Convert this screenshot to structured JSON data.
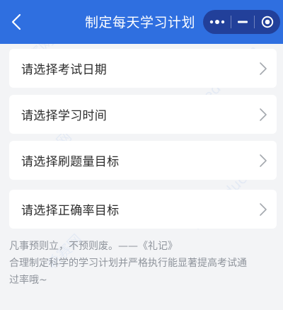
{
  "header": {
    "title": "制定每天学习计划",
    "back_icon": "chevron-left-icon",
    "more_icon": "more-dots-icon",
    "minimize_icon": "minimize-icon",
    "close_icon": "target-close-icon"
  },
  "options": [
    {
      "label": "请选择考试日期"
    },
    {
      "label": "请选择学习时间"
    },
    {
      "label": "请选择刷题量目标"
    },
    {
      "label": "请选择正确率目标"
    }
  ],
  "footer": {
    "quote": "凡事预则立，不预则废。——《礼记》",
    "desc_line1": "合理制定科学的学习计划并严格执行能显著提高考试通",
    "desc_line2": "过率哦~"
  },
  "watermark": {
    "text_cn": "希赛网",
    "text_url": "www.educity.cn"
  },
  "colors": {
    "header_bg": "#2f6fe0",
    "capsule_bg": "#22409a",
    "page_bg": "#f3f4f6",
    "card_bg": "#ffffff",
    "footer_text": "#8f949c"
  }
}
